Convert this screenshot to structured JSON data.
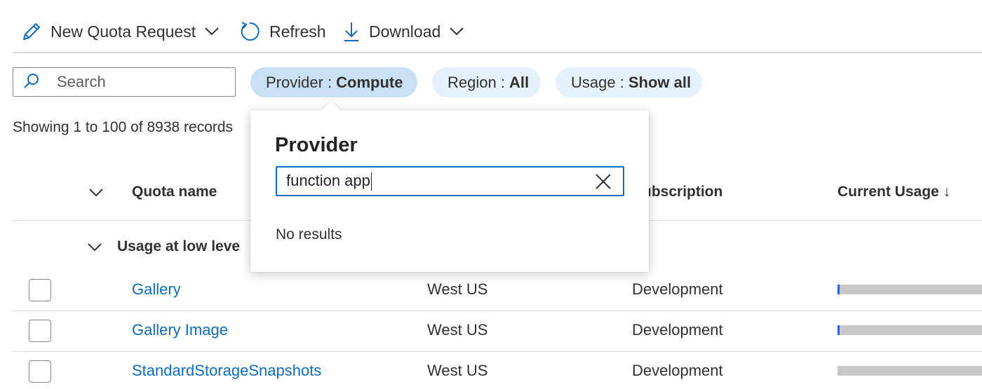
{
  "toolbar": {
    "new_quota_label": "New Quota Request",
    "refresh_label": "Refresh",
    "download_label": "Download"
  },
  "filters": {
    "search_placeholder": "Search",
    "provider": {
      "key": "Provider :",
      "value": "Compute"
    },
    "region": {
      "key": "Region :",
      "value": "All"
    },
    "usage": {
      "key": "Usage :",
      "value": "Show all"
    }
  },
  "records_text": "Showing 1 to 100 of 8938 records",
  "table": {
    "columns": {
      "quota_name": "Quota name",
      "subscription": "Subscription",
      "current_usage": "Current Usage ↓"
    },
    "group_label": "Usage at low leve",
    "rows": [
      {
        "name": "Gallery",
        "region": "West US",
        "subscription": "Development",
        "usage_fraction": 0.01
      },
      {
        "name": "Gallery Image",
        "region": "West US",
        "subscription": "Development",
        "usage_fraction": 0.01
      },
      {
        "name": "StandardStorageSnapshots",
        "region": "West US",
        "subscription": "Development",
        "usage_fraction": 0
      }
    ]
  },
  "popup": {
    "title": "Provider",
    "input_value": "function app",
    "empty_text": "No results"
  },
  "colors": {
    "accent": "#0f6cbd",
    "pill_bg": "#e6f2fb",
    "pill_active_bg": "#c7e0f4",
    "bar_track": "#c8c8c8",
    "bar_fill": "#2266e3"
  },
  "icons": {
    "new_quota": "pencil-icon",
    "refresh": "refresh-icon",
    "download": "download-icon",
    "search": "search-icon",
    "clear": "close-icon"
  }
}
